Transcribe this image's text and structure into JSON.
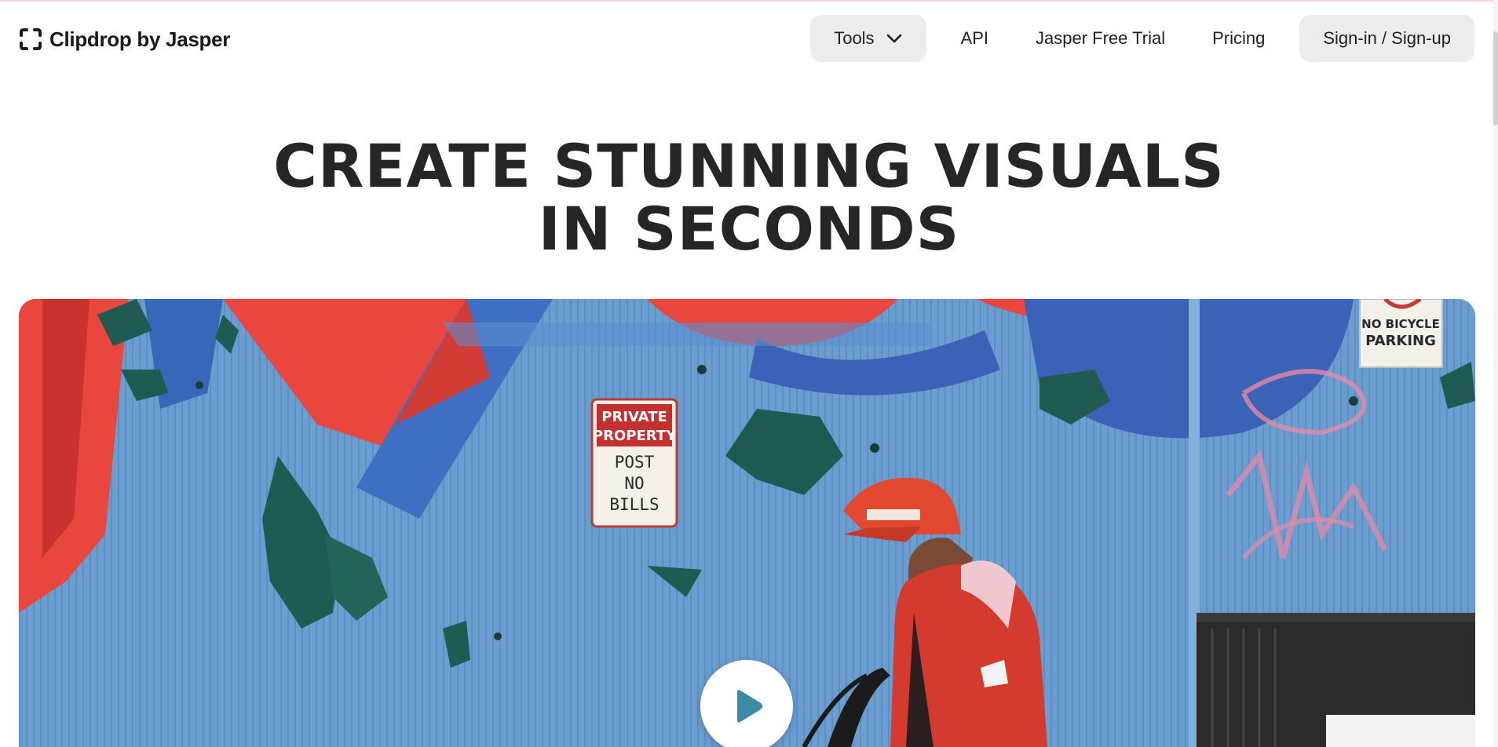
{
  "brand": {
    "name": "Clipdrop by Jasper",
    "logo_icon": "bracket-frame-icon"
  },
  "nav": {
    "tools_label": "Tools",
    "api_label": "API",
    "trial_label": "Jasper Free Trial",
    "pricing_label": "Pricing",
    "signin_label": "Sign-in / Sign-up"
  },
  "hero": {
    "title_line1": "CREATE STUNNING VISUALS",
    "title_line2": "IN SECONDS"
  },
  "media": {
    "sign_private": [
      "PRIVATE",
      "PROPERTY"
    ],
    "sign_post": [
      "POST",
      "NO",
      "BILLS"
    ],
    "sign_bicycle": [
      "NO BICYCLE",
      "PARKING"
    ],
    "play_icon": "play-icon"
  },
  "colors": {
    "accent_red": "#e8463f",
    "wall_blue": "#5e93c9",
    "text_dark": "#262626",
    "pill_bg": "#ececec"
  }
}
